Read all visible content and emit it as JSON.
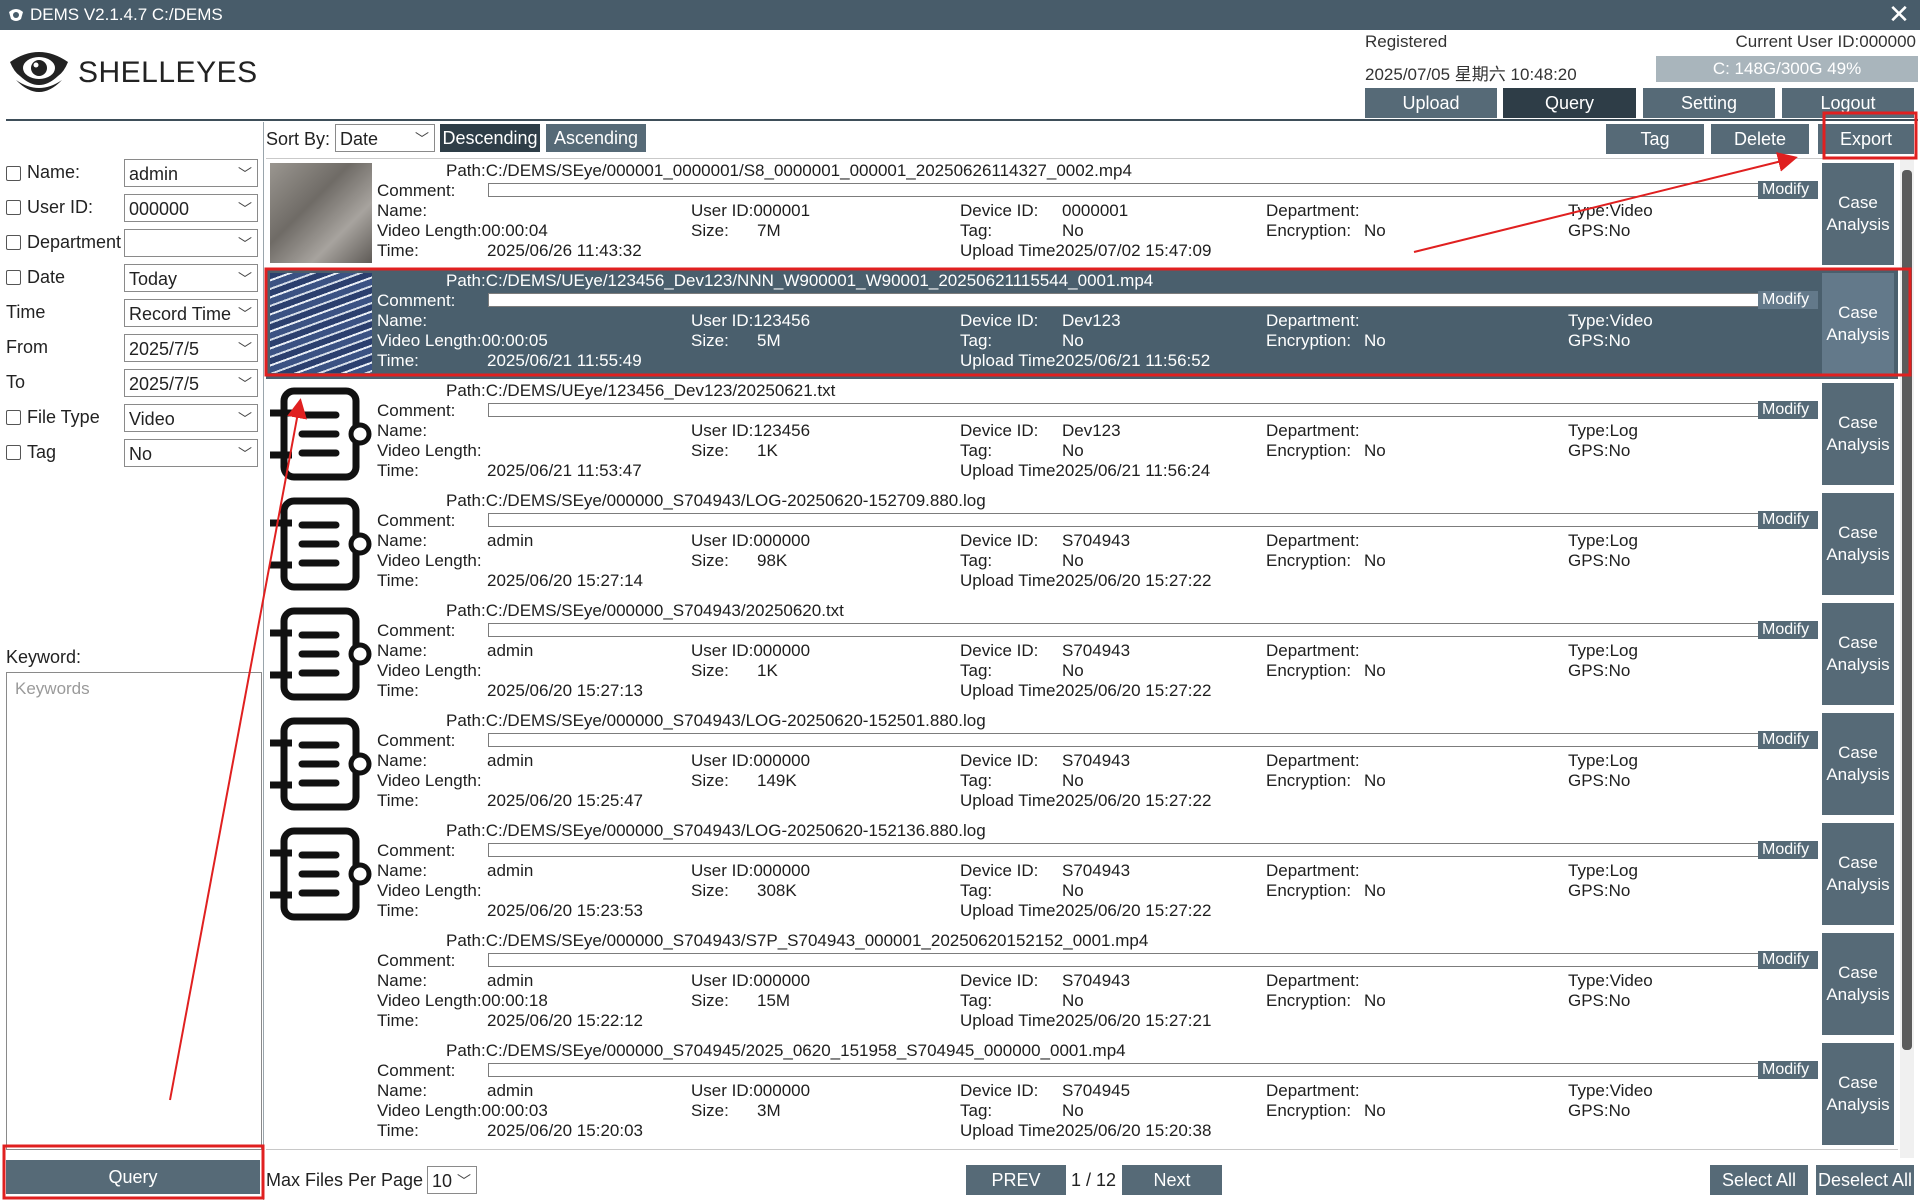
{
  "window": {
    "title": "DEMS V2.1.4.7  C:/DEMS"
  },
  "brand": {
    "name": "SHELLEYES"
  },
  "header": {
    "status": "Registered",
    "datetime": "2025/07/05 星期六 10:48:20",
    "current_user": "Current User ID:000000",
    "disk": "C: 148G/300G 49%"
  },
  "nav": {
    "upload": "Upload",
    "query": "Query",
    "setting": "Setting",
    "logout": "Logout"
  },
  "filters": {
    "name_label": "Name:",
    "name_value": "admin",
    "userid_label": "User ID:",
    "userid_value": "000000",
    "department_label": "Department",
    "department_value": "",
    "date_label": "Date",
    "date_value": "Today",
    "time_label": "Time",
    "time_value": "Record Time",
    "from_label": "From",
    "from_value": "2025/7/5",
    "to_label": "To",
    "to_value": "2025/7/5",
    "filetype_label": "File Type",
    "filetype_value": "Video",
    "tag_label": "Tag",
    "tag_value": "No",
    "keyword_label": "Keyword:",
    "keyword_placeholder": "Keywords",
    "query_button": "Query"
  },
  "toolbar": {
    "sort_by_label": "Sort By:",
    "sort_value": "Date",
    "descending": "Descending",
    "ascending": "Ascending",
    "tag": "Tag",
    "delete": "Delete",
    "export": "Export"
  },
  "labels": {
    "comment": "Comment:",
    "name": "Name:",
    "video_length": "Video Length:",
    "time": "Time:",
    "user_id": "User ID:",
    "size": "Size:",
    "device_id": "Device ID:",
    "tag": "Tag:",
    "upload_time": "Upload Time",
    "department": "Department:",
    "encryption": "Encryption:",
    "type": "Type:",
    "gps": "GPS:",
    "modify": "Modify",
    "case_1": "Case",
    "case_2": "Analysis"
  },
  "files": [
    {
      "thumb": "concrete",
      "path": "Path:C:/DEMS/SEye/000001_0000001/S8_0000001_000001_20250626114327_0002.mp4",
      "name": "",
      "video_length": "00:00:04",
      "time": "2025/06/26  11:43:32",
      "user_id": "000001",
      "size": "7M",
      "device_id": "0000001",
      "tag": "No",
      "upload_time": "2025/07/02  15:47:09",
      "encryption": "No",
      "type": "Video",
      "gps": "No"
    },
    {
      "thumb": "keyboard",
      "path": "Path:C:/DEMS/UEye/123456_Dev123/NNN_W900001_W90001_20250621115544_0001.mp4",
      "name": "",
      "video_length": "00:00:05",
      "time": "2025/06/21  11:55:49",
      "user_id": "123456",
      "size": "5M",
      "device_id": "Dev123",
      "tag": "No",
      "upload_time": "2025/06/21  11:56:52",
      "encryption": "No",
      "type": "Video",
      "gps": "No",
      "selected": true
    },
    {
      "thumb": "log",
      "path": "Path:C:/DEMS/UEye/123456_Dev123/20250621.txt",
      "name": "",
      "video_length": "",
      "time": "2025/06/21  11:53:47",
      "user_id": "123456",
      "size": "1K",
      "device_id": "Dev123",
      "tag": "No",
      "upload_time": "2025/06/21  11:56:24",
      "encryption": "No",
      "type": "Log",
      "gps": "No"
    },
    {
      "thumb": "log",
      "path": "Path:C:/DEMS/SEye/000000_S704943/LOG-20250620-152709.880.log",
      "name": "admin",
      "video_length": "",
      "time": "2025/06/20  15:27:14",
      "user_id": "000000",
      "size": "98K",
      "device_id": "S704943",
      "tag": "No",
      "upload_time": "2025/06/20  15:27:22",
      "encryption": "No",
      "type": "Log",
      "gps": "No"
    },
    {
      "thumb": "log",
      "path": "Path:C:/DEMS/SEye/000000_S704943/20250620.txt",
      "name": "admin",
      "video_length": "",
      "time": "2025/06/20  15:27:13",
      "user_id": "000000",
      "size": "1K",
      "device_id": "S704943",
      "tag": "No",
      "upload_time": "2025/06/20  15:27:22",
      "encryption": "No",
      "type": "Log",
      "gps": "No"
    },
    {
      "thumb": "log",
      "path": "Path:C:/DEMS/SEye/000000_S704943/LOG-20250620-152501.880.log",
      "name": "admin",
      "video_length": "",
      "time": "2025/06/20  15:25:47",
      "user_id": "000000",
      "size": "149K",
      "device_id": "S704943",
      "tag": "No",
      "upload_time": "2025/06/20  15:27:22",
      "encryption": "No",
      "type": "Log",
      "gps": "No"
    },
    {
      "thumb": "log",
      "path": "Path:C:/DEMS/SEye/000000_S704943/LOG-20250620-152136.880.log",
      "name": "admin",
      "video_length": "",
      "time": "2025/06/20  15:23:53",
      "user_id": "000000",
      "size": "308K",
      "device_id": "S704943",
      "tag": "No",
      "upload_time": "2025/06/20  15:27:22",
      "encryption": "No",
      "type": "Log",
      "gps": "No"
    },
    {
      "thumb": "none",
      "path": "Path:C:/DEMS/SEye/000000_S704943/S7P_S704943_000001_20250620152152_0001.mp4",
      "name": "admin",
      "video_length": "00:00:18",
      "time": "2025/06/20  15:22:12",
      "user_id": "000000",
      "size": "15M",
      "device_id": "S704943",
      "tag": "No",
      "upload_time": "2025/06/20  15:27:21",
      "encryption": "No",
      "type": "Video",
      "gps": "No"
    },
    {
      "thumb": "none",
      "path": "Path:C:/DEMS/SEye/000000_S704945/2025_0620_151958_S704945_000000_0001.mp4",
      "name": "admin",
      "video_length": "00:00:03",
      "time": "2025/06/20  15:20:03",
      "user_id": "000000",
      "size": "3M",
      "device_id": "S704945",
      "tag": "No",
      "upload_time": "2025/06/20  15:20:38",
      "encryption": "No",
      "type": "Video",
      "gps": "No"
    }
  ],
  "footer": {
    "max_files_label": "Max Files Per Page",
    "max_files_value": "10",
    "prev": "PREV",
    "page": "1 / 12",
    "next": "Next",
    "select_all": "Select All",
    "deselect_all": "Deselect All"
  },
  "colors": {
    "primary": "#566a77",
    "active": "#2e3d47",
    "selected_row": "#4a5f6d",
    "annotation": "#e02020"
  }
}
